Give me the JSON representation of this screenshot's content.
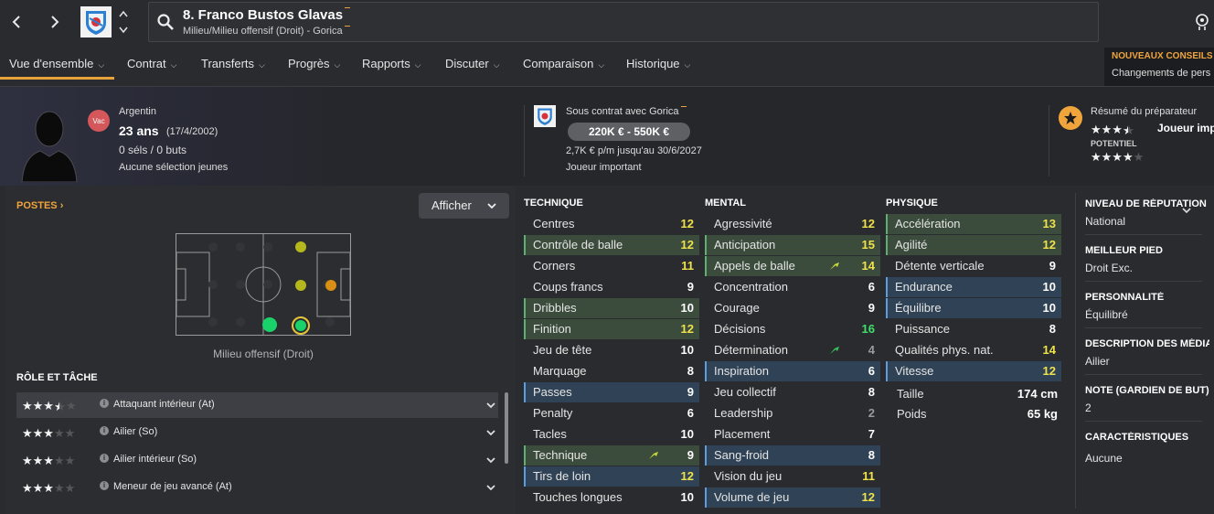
{
  "player": {
    "name": "8. Franco Bustos Glavas",
    "subtitle": "Milieu/Milieu offensif (Droit) - Gorica"
  },
  "tabs": [
    {
      "label": "Vue d'ensemble"
    },
    {
      "label": "Contrat"
    },
    {
      "label": "Transferts"
    },
    {
      "label": "Progrès"
    },
    {
      "label": "Rapports"
    },
    {
      "label": "Discuter"
    },
    {
      "label": "Comparaison"
    },
    {
      "label": "Historique"
    }
  ],
  "advice": {
    "title": "NOUVEAUX CONSEILS D",
    "text": "Changements de pers"
  },
  "profile": {
    "badge": "Vac",
    "nationality": "Argentin",
    "age": "23 ans",
    "birthdate": "(17/4/2002)",
    "caps": "0 séls / 0 buts",
    "youth": "Aucune sélection jeunes"
  },
  "contract": {
    "club": "Sous contrat avec Gorica",
    "value": "220K € - 550K €",
    "wage": "2,7K € p/m jusqu'au 30/6/2027",
    "status": "Joueur important"
  },
  "coach": {
    "title": "Résumé du préparateur",
    "role": "Joueur imp",
    "potential_label": "POTENTIEL",
    "ability_stars": 3.5,
    "potential_stars": 4
  },
  "positions": {
    "title": "POSTES",
    "show_button": "Afficher",
    "caption": "Milieu offensif (Droit)",
    "ratings": [
      {
        "position": "MC droit",
        "level": "competent",
        "color": "#b5b81c"
      },
      {
        "position": "MO centre",
        "level": "competent",
        "color": "#b5b81c"
      },
      {
        "position": "M droit",
        "level": "unconvincing",
        "color": "#d98e14"
      },
      {
        "position": "MO gauche",
        "level": "natural",
        "color": "#19d36a"
      },
      {
        "position": "MO droit",
        "level": "natural-selected",
        "color": "#19d36a"
      }
    ]
  },
  "roles": {
    "title": "RÔLE ET TÂCHE",
    "items": [
      {
        "label": "Attaquant intérieur (At)",
        "stars": 3.5,
        "selected": true
      },
      {
        "label": "Ailier (So)",
        "stars": 3,
        "selected": false
      },
      {
        "label": "Ailier intérieur (So)",
        "stars": 3,
        "selected": false
      },
      {
        "label": "Meneur de jeu avancé (At)",
        "stars": 3,
        "selected": false
      }
    ]
  },
  "attributes": {
    "technique": {
      "title": "TECHNIQUE",
      "rows": [
        {
          "name": "Centres",
          "value": "12",
          "hl": "n",
          "color": "#f0e24a"
        },
        {
          "name": "Contrôle de balle",
          "value": "12",
          "hl": "g",
          "color": "#f0e24a"
        },
        {
          "name": "Corners",
          "value": "11",
          "hl": "n",
          "color": "#f0e24a"
        },
        {
          "name": "Coups francs",
          "value": "9",
          "hl": "n",
          "color": "#ffffff"
        },
        {
          "name": "Dribbles",
          "value": "10",
          "hl": "g",
          "color": "#ffffff"
        },
        {
          "name": "Finition",
          "value": "12",
          "hl": "g",
          "color": "#f0e24a"
        },
        {
          "name": "Jeu de tête",
          "value": "10",
          "hl": "n",
          "color": "#ffffff"
        },
        {
          "name": "Marquage",
          "value": "8",
          "hl": "n",
          "color": "#ffffff"
        },
        {
          "name": "Passes",
          "value": "9",
          "hl": "b",
          "color": "#ffffff"
        },
        {
          "name": "Penalty",
          "value": "6",
          "hl": "n",
          "color": "#ffffff"
        },
        {
          "name": "Tacles",
          "value": "10",
          "hl": "n",
          "color": "#ffffff"
        },
        {
          "name": "Technique",
          "value": "9",
          "hl": "g",
          "color": "#ffffff",
          "arrow": "up"
        },
        {
          "name": "Tirs de loin",
          "value": "12",
          "hl": "b",
          "color": "#f0e24a"
        },
        {
          "name": "Touches longues",
          "value": "10",
          "hl": "n",
          "color": "#ffffff"
        }
      ]
    },
    "mental": {
      "title": "MENTAL",
      "rows": [
        {
          "name": "Agressivité",
          "value": "12",
          "hl": "n",
          "color": "#f0e24a"
        },
        {
          "name": "Anticipation",
          "value": "15",
          "hl": "g",
          "color": "#f0e24a"
        },
        {
          "name": "Appels de balle",
          "value": "14",
          "hl": "g",
          "color": "#f0e24a",
          "arrow": "up"
        },
        {
          "name": "Concentration",
          "value": "6",
          "hl": "n",
          "color": "#ffffff"
        },
        {
          "name": "Courage",
          "value": "9",
          "hl": "n",
          "color": "#ffffff"
        },
        {
          "name": "Décisions",
          "value": "16",
          "hl": "n",
          "color": "#3fe06a"
        },
        {
          "name": "Détermination",
          "value": "4",
          "hl": "n",
          "color": "#9a9a9a",
          "arrow": "up-green"
        },
        {
          "name": "Inspiration",
          "value": "6",
          "hl": "b",
          "color": "#ffffff"
        },
        {
          "name": "Jeu collectif",
          "value": "8",
          "hl": "n",
          "color": "#ffffff"
        },
        {
          "name": "Leadership",
          "value": "2",
          "hl": "n",
          "color": "#9a9a9a"
        },
        {
          "name": "Placement",
          "value": "7",
          "hl": "n",
          "color": "#ffffff"
        },
        {
          "name": "Sang-froid",
          "value": "8",
          "hl": "b",
          "color": "#ffffff"
        },
        {
          "name": "Vision du jeu",
          "value": "11",
          "hl": "n",
          "color": "#f0e24a"
        },
        {
          "name": "Volume de jeu",
          "value": "12",
          "hl": "b",
          "color": "#f0e24a"
        }
      ]
    },
    "physique": {
      "title": "PHYSIQUE",
      "rows": [
        {
          "name": "Accélération",
          "value": "13",
          "hl": "g",
          "color": "#f0e24a"
        },
        {
          "name": "Agilité",
          "value": "12",
          "hl": "g",
          "color": "#f0e24a"
        },
        {
          "name": "Détente verticale",
          "value": "9",
          "hl": "n",
          "color": "#ffffff"
        },
        {
          "name": "Endurance",
          "value": "10",
          "hl": "b",
          "color": "#ffffff"
        },
        {
          "name": "Équilibre",
          "value": "10",
          "hl": "b",
          "color": "#ffffff"
        },
        {
          "name": "Puissance",
          "value": "8",
          "hl": "n",
          "color": "#ffffff"
        },
        {
          "name": "Qualités phys. nat.",
          "value": "14",
          "hl": "n",
          "color": "#f0e24a"
        },
        {
          "name": "Vitesse",
          "value": "12",
          "hl": "b",
          "color": "#f0e24a"
        }
      ],
      "height_label": "Taille",
      "height": "174 cm",
      "weight_label": "Poids",
      "weight": "65 kg"
    }
  },
  "info": [
    {
      "label": "NIVEAU DE RÉPUTATION",
      "value": "National"
    },
    {
      "label": "MEILLEUR PIED",
      "value": "Droit Exc."
    },
    {
      "label": "PERSONNALITÉ",
      "value": "Équilibré"
    },
    {
      "label": "DESCRIPTION DES MÉDIAS",
      "value": "Ailier"
    },
    {
      "label": "NOTE (GARDIEN DE BUT)",
      "value": "2"
    },
    {
      "label": "CARACTÉRISTIQUES",
      "value": "Aucune"
    }
  ]
}
